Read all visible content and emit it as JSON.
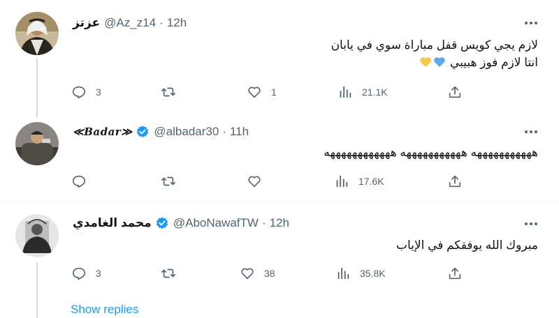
{
  "tweets": [
    {
      "name": "عزتز",
      "handle": "@Az_z14",
      "dot": "·",
      "time": "12h",
      "lines": [
        "لازم يجي كويس قفل مباراة سوي في يابان",
        "انتا لازم فوز هبيبي"
      ],
      "reply_count": "3",
      "retweet_count": "",
      "like_count": "1",
      "view_count": "21.1K",
      "verified": false
    },
    {
      "name": "≪Badar≫",
      "handle": "@albadar30",
      "dot": "·",
      "time": "11h",
      "lines": [
        "هههههههههههه هههههههههههه ههههههههههههه"
      ],
      "reply_count": "",
      "retweet_count": "",
      "like_count": "",
      "view_count": "17.6K",
      "verified": true
    },
    {
      "name": "محمد الغامدي",
      "handle": "@AboNawafTW",
      "dot": "·",
      "time": "12h",
      "lines": [
        "مبروك الله يوفقكم في الإياب"
      ],
      "reply_count": "3",
      "retweet_count": "",
      "like_count": "38",
      "view_count": "35.8K",
      "verified": true
    }
  ],
  "show_replies": "Show replies",
  "colors": {
    "accent": "#1d9bf0",
    "secondary_text": "#536471",
    "thread_line": "#cfd9de",
    "heart_blue": "#5ea9e8",
    "heart_yellow": "#f7c948"
  }
}
